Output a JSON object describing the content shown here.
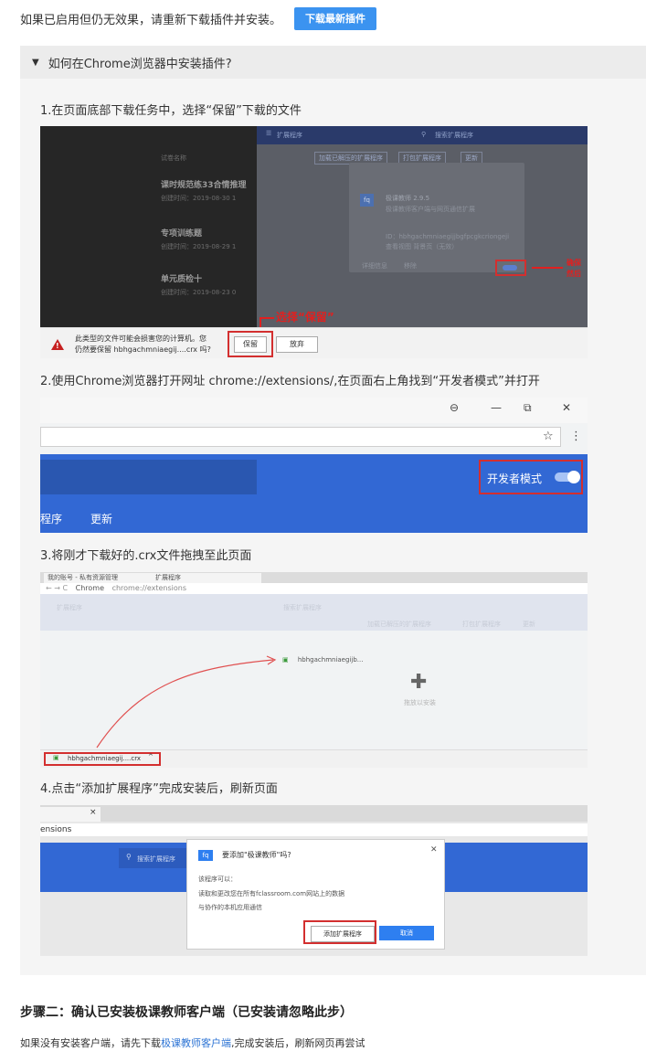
{
  "top": {
    "text": "如果已启用但仍无效果，请重新下载插件并安装。",
    "download_button": "下载最新插件"
  },
  "faq": {
    "title": "如何在Chrome浏览器中安装插件?",
    "steps": [
      "1.在页面底部下载任务中，选择“保留”下载的文件",
      "2.使用Chrome浏览器打开网址 chrome://extensions/,在页面右上角找到“开发者模式”并打开",
      "3.将刚才下载好的.crx文件拖拽至此页面",
      "4.点击“添加扩展程序”完成安装后，刷新页面"
    ]
  },
  "shot1": {
    "list_header": "试卷名称",
    "items": [
      {
        "title": "课时规范练33合情推理",
        "sub": "创建时间：2019-08-30 1"
      },
      {
        "title": "专项训练题",
        "sub": "创建时间：2019-08-29 1"
      },
      {
        "title": "单元质检十",
        "sub": "创建时间：2019-08-23 0"
      }
    ],
    "ext_bar_title": "扩展程序",
    "ext_search": "搜索扩展程序",
    "ext_buttons": [
      "加载已解压的扩展程序",
      "打包扩展程序",
      "更新"
    ],
    "ext_card_name": "极课教师 2.9.5",
    "ext_card_desc": "极课教师客户端与网页通信扩展",
    "ext_card_id": "ID：hbhgachmniaegijjbgfpcgkcriongeji",
    "ext_card_view": "查看视图 背景页（无效）",
    "ext_card_btns": [
      "详细信息",
      "移除"
    ],
    "annotation_keep": "选择“保留”",
    "annotation_right": "确保\n然后",
    "warning_line1": "此类型的文件可能会损害您的计算机。您",
    "warning_line2": "仍然要保留 hbhgachmniaegij....crx 吗?",
    "keep_button": "保留",
    "discard_button": "放弃"
  },
  "shot2": {
    "dev_mode": "开发者模式",
    "partial_label": "程序",
    "update": "更新",
    "window_controls": [
      "⊖",
      "—",
      "⧉",
      "✕"
    ],
    "addr_icons": [
      "☆",
      "⋮"
    ]
  },
  "shot3": {
    "tab1": "我的账号 - 私有资源管理",
    "tab2": "扩展程序",
    "url_prefix": "Chrome",
    "url": "chrome://extensions",
    "ext_title": "扩展程序",
    "search": "搜索扩展程序",
    "ext_buttons": [
      "加载已解压的扩展程序",
      "打包扩展程序",
      "更新"
    ],
    "file_dragged": "hbhgachmniaegijb...",
    "drop_text": "拖放以安装",
    "download_file": "hbhgachmniaegij....crx"
  },
  "shot4": {
    "addr": "ensions",
    "search": "搜索扩展程序",
    "dialog_logo": "fq",
    "dialog_title": "要添加\"极课教师\"吗?",
    "can_label": "该程序可以：",
    "perm1": "读取和更改您在所有fclassroom.com网站上的数据",
    "perm2": "与协作的本机应用通信",
    "add_button": "添加扩展程序",
    "cancel_button": "取消"
  },
  "step2": {
    "title": "步骤二：确认已安装极课教师客户端（已安装请忽略此步）",
    "text_before": "如果没有安装客户端，请先下载",
    "link": "极课教师客户端",
    "text_after": ",完成安装后，刷新网页再尝试"
  },
  "colors": {
    "primary": "#3b93f0",
    "chrome_blue": "#3268d4",
    "annotation_red": "#d32f2f"
  }
}
